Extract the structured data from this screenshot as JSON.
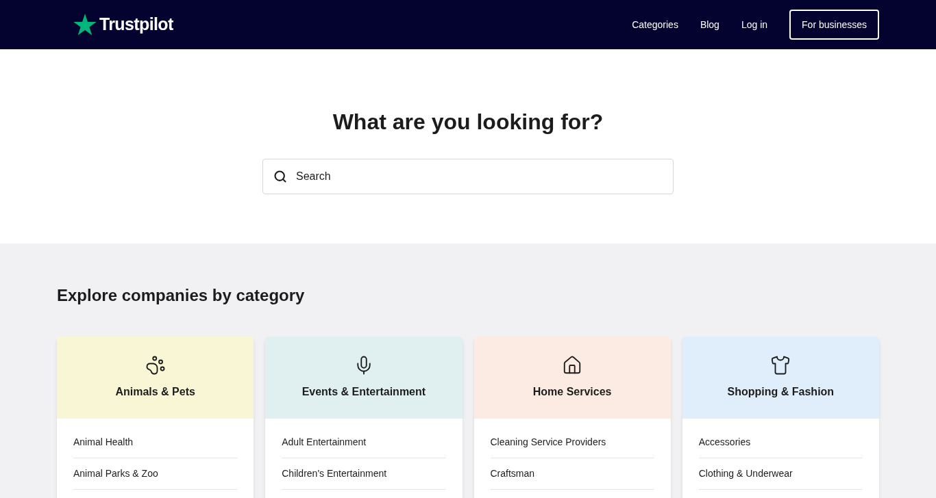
{
  "header": {
    "logo": "Trustpilot",
    "nav": [
      "Categories",
      "Blog",
      "Log in"
    ],
    "business_button": "For businesses"
  },
  "hero": {
    "title": "What are you looking for?",
    "search": {
      "placeholder": "Search"
    }
  },
  "explore": {
    "title": "Explore companies by category",
    "cards": [
      {
        "title": "Animals & Pets",
        "color": "#f9f6d6",
        "items": [
          "Animal Health",
          "Animal Parks & Zoo"
        ]
      },
      {
        "title": "Events & Entertainment",
        "color": "#e0eff0",
        "items": [
          "Adult Entertainment",
          "Children's Entertainment"
        ]
      },
      {
        "title": "Home Services",
        "color": "#fcebe3",
        "items": [
          "Cleaning Service Providers",
          "Craftsman"
        ]
      },
      {
        "title": "Shopping & Fashion",
        "color": "#e0edfb",
        "items": [
          "Accessories",
          "Clothing & Underwear"
        ]
      }
    ]
  }
}
